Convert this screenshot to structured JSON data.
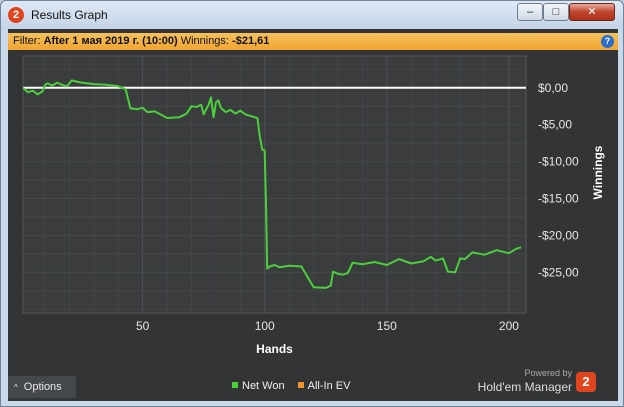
{
  "window": {
    "title": "Results Graph",
    "icon_label": "2",
    "close_glyph": "✕",
    "max_glyph": "□",
    "min_glyph": "–"
  },
  "filter": {
    "prefix": "Filter:",
    "value": "After 1 мая 2019 г. (10:00)",
    "winnings_label": "Winnings:",
    "winnings_value": "-$21,61",
    "help_glyph": "?"
  },
  "options": {
    "label": "Options",
    "chevron": "^"
  },
  "legend": [
    {
      "label": "Net Won",
      "color": "#4bd03b"
    },
    {
      "label": "All-In EV",
      "color": "#f0922d"
    }
  ],
  "branding": {
    "powered_by": "Powered by",
    "name": "Hold'em Manager",
    "logo_label": "2"
  },
  "colors": {
    "background": "#323436",
    "grid": "#45484b",
    "zero_line": "#ffffff",
    "net_won": "#4bd03b",
    "filter_bar": "#f4b240"
  },
  "chart_data": {
    "type": "line",
    "xlabel": "Hands",
    "ylabel": "Winnings",
    "xlim": [
      1,
      207
    ],
    "ylim": [
      -30.5,
      4.3
    ],
    "x_ticks": [
      50,
      100,
      150,
      200
    ],
    "x_tick_labels": [
      "50",
      "100",
      "150",
      "200"
    ],
    "y_ticks": [
      0,
      -5,
      -10,
      -15,
      -20,
      -25
    ],
    "y_tick_labels": [
      "$0,00",
      "-$5,00",
      "-$10,00",
      "-$15,00",
      "-$20,00",
      "-$25,00"
    ],
    "grid": true,
    "legend_position": "bottom",
    "zero_line": 0,
    "series": [
      {
        "name": "Net Won",
        "color": "#4bd03b",
        "x": [
          1,
          3,
          5,
          7,
          9,
          10,
          11,
          13,
          15,
          17,
          19,
          21,
          22,
          25,
          30,
          35,
          40,
          43,
          44,
          45,
          48,
          50,
          52,
          55,
          60,
          65,
          68,
          70,
          72,
          74,
          75,
          77,
          78,
          79,
          80,
          81,
          82,
          84,
          86,
          88,
          90,
          92,
          95,
          97,
          98,
          99,
          100,
          100.5,
          101,
          102,
          104,
          106,
          110,
          115,
          120,
          125,
          127,
          128,
          130,
          132,
          134,
          136,
          140,
          145,
          150,
          155,
          160,
          165,
          168,
          170,
          173,
          175,
          178,
          180,
          182,
          185,
          190,
          195,
          200,
          203,
          205
        ],
        "y": [
          0,
          -0.6,
          -0.4,
          -0.9,
          -0.5,
          0.4,
          0.6,
          0.3,
          0.7,
          0.4,
          0.2,
          1.0,
          0.9,
          0.7,
          0.5,
          0.4,
          0.2,
          -0.2,
          -1.5,
          -2.8,
          -2.9,
          -2.7,
          -3.3,
          -3.2,
          -4.1,
          -4.0,
          -3.5,
          -2.5,
          -2.6,
          -2.3,
          -3.6,
          -2.3,
          -1.3,
          -4.0,
          -2.0,
          -1.7,
          -2.7,
          -3.3,
          -3.0,
          -3.5,
          -3.1,
          -3.6,
          -3.9,
          -4.1,
          -6.6,
          -8.4,
          -8.5,
          -16.0,
          -24.5,
          -24.2,
          -24.0,
          -24.3,
          -24.1,
          -24.2,
          -27.0,
          -27.1,
          -26.8,
          -24.9,
          -25.2,
          -25.3,
          -25.1,
          -23.7,
          -23.9,
          -23.6,
          -24.0,
          -23.2,
          -23.8,
          -23.5,
          -22.9,
          -23.4,
          -23.1,
          -24.9,
          -25.0,
          -23.1,
          -23.2,
          -22.3,
          -22.6,
          -22.0,
          -22.4,
          -21.8,
          -21.6
        ]
      }
    ]
  }
}
